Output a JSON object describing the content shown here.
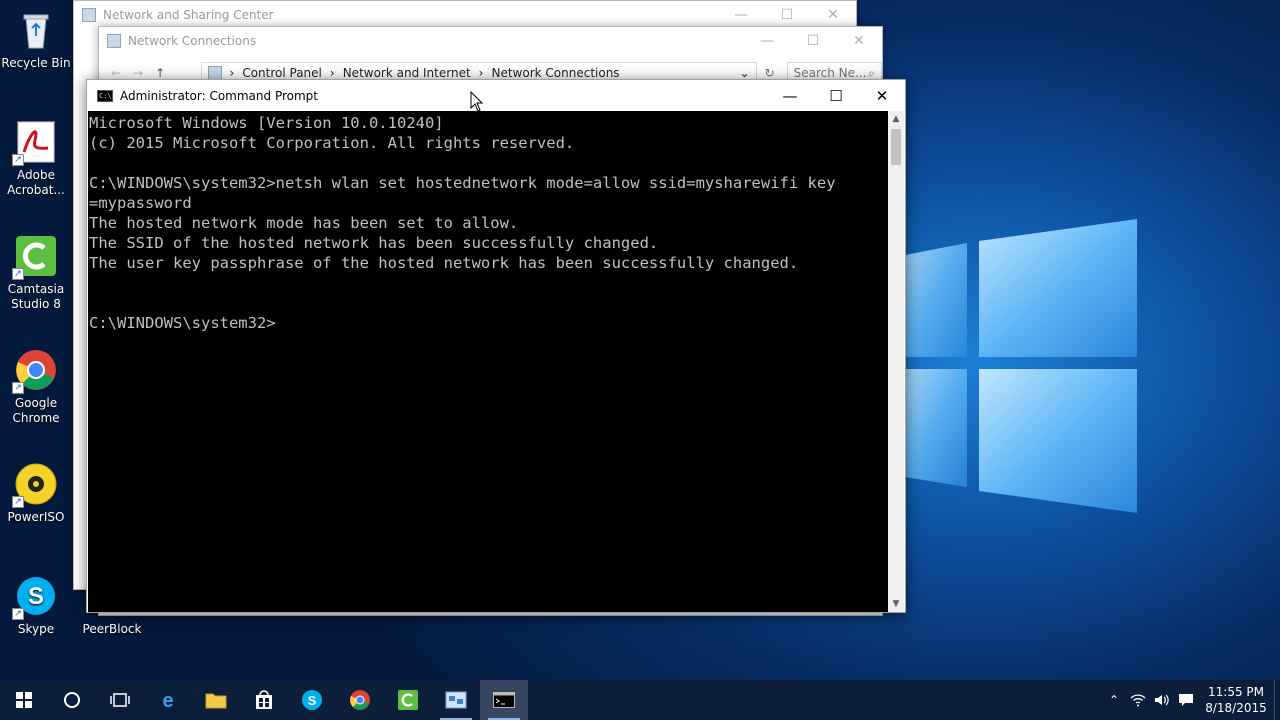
{
  "desktop": {
    "icons": [
      {
        "label": "Recycle Bin",
        "icon": "recycle-bin-icon"
      },
      {
        "label": "Adobe Acrobat...",
        "icon": "adobe-acrobat-icon"
      },
      {
        "label": "Camtasia Studio 8",
        "icon": "camtasia-icon"
      },
      {
        "label": "Google Chrome",
        "icon": "chrome-icon"
      },
      {
        "label": "PowerISO",
        "icon": "poweriso-icon"
      },
      {
        "label": "Skype",
        "icon": "skype-icon"
      },
      {
        "label": "PeerBlock",
        "icon": "peerblock-icon"
      }
    ]
  },
  "windows": {
    "sharing_center": {
      "title": "Network and Sharing Center"
    },
    "connections": {
      "title": "Network Connections",
      "breadcrumb": [
        "Control Panel",
        "Network and Internet",
        "Network Connections"
      ],
      "search_placeholder": "Search Ne..."
    },
    "cmd": {
      "title": "Administrator: Command Prompt",
      "lines": [
        "Microsoft Windows [Version 10.0.10240]",
        "(c) 2015 Microsoft Corporation. All rights reserved.",
        "",
        "C:\\WINDOWS\\system32>netsh wlan set hostednetwork mode=allow ssid=mysharewifi key",
        "=mypassword",
        "The hosted network mode has been set to allow.",
        "The SSID of the hosted network has been successfully changed.",
        "The user key passphrase of the hosted network has been successfully changed.",
        "",
        "",
        "C:\\WINDOWS\\system32>"
      ]
    }
  },
  "controls": {
    "minimize": "—",
    "maximize": "☐",
    "close": "✕"
  },
  "taskbar": {
    "time": "11:55 PM",
    "date": "8/18/2015"
  },
  "colors": {
    "console_bg": "#000000",
    "console_fg": "#c0c0c0",
    "taskbar_bg": "#0b1f3a",
    "accent": "#1c7fd6"
  }
}
